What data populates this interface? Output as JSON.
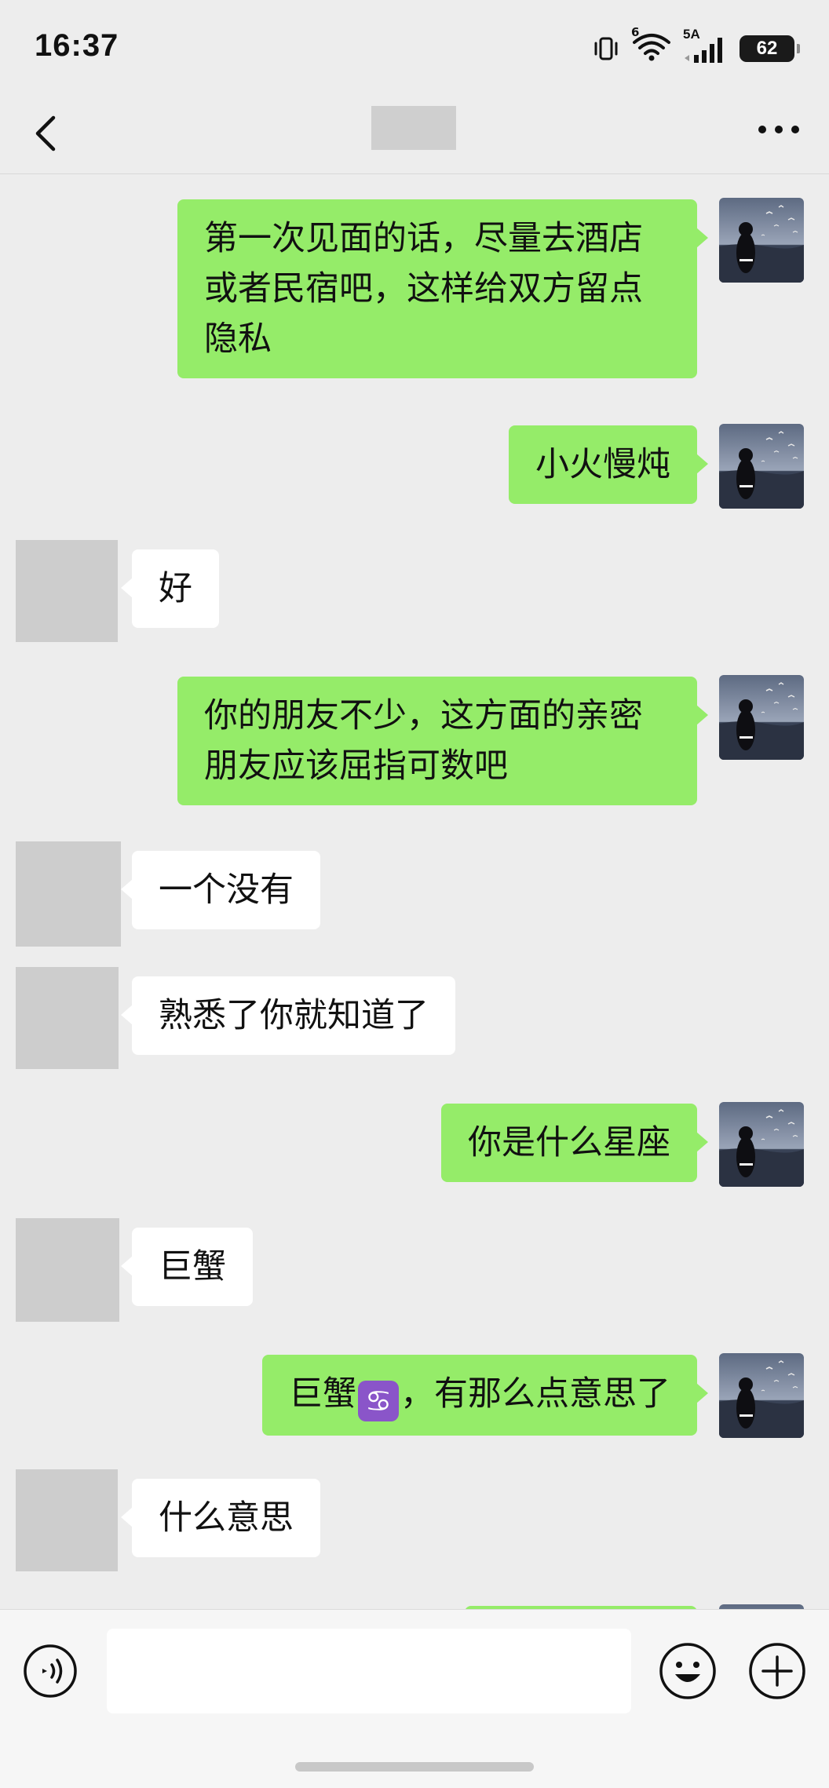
{
  "status_bar": {
    "time": "16:37",
    "wifi_label": "6",
    "network_label": "5A",
    "battery_level": "62",
    "icons": [
      "vibrate-icon",
      "wifi-icon",
      "cellular-signal-icon",
      "battery-icon"
    ]
  },
  "nav": {
    "back_icon": "chevron-left-icon",
    "more_icon": "more-dots-icon"
  },
  "messages": [
    {
      "side": "sent",
      "text": "第一次见面的话，尽量去酒店或者民宿吧，这样给双方留点隐私"
    },
    {
      "side": "sent",
      "text": "小火慢炖"
    },
    {
      "side": "received",
      "text": "好"
    },
    {
      "side": "sent",
      "text": "你的朋友不少，这方面的亲密朋友应该屈指可数吧"
    },
    {
      "side": "received",
      "text": "一个没有"
    },
    {
      "side": "received",
      "text": "熟悉了你就知道了"
    },
    {
      "side": "sent",
      "text": "你是什么星座"
    },
    {
      "side": "received",
      "text": "巨蟹"
    },
    {
      "side": "sent",
      "text_before": "巨蟹",
      "emoji": "♋",
      "text_after": "，有那么点意思了"
    },
    {
      "side": "received",
      "text": "什么意思"
    }
  ],
  "input_bar": {
    "voice_icon": "voice-icon",
    "message_value": "",
    "emoji_icon": "emoji-icon",
    "plus_icon": "plus-icon"
  },
  "colors": {
    "background": "#ededed",
    "sent_bubble": "#95ec69",
    "received_bubble": "#ffffff",
    "avatar_placeholder": "#cdcdcd"
  }
}
